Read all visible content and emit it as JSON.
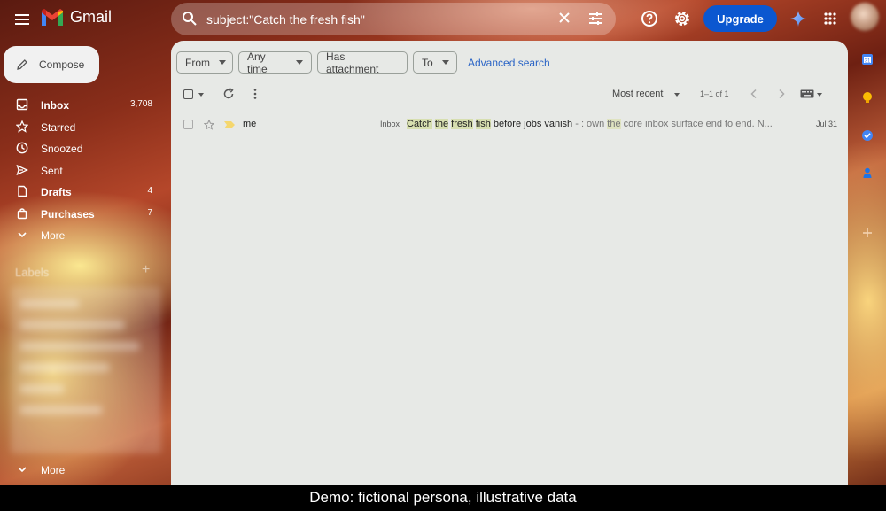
{
  "app": {
    "name": "Gmail"
  },
  "search": {
    "query": "subject:\"Catch the fresh fish\""
  },
  "header": {
    "upgrade_label": "Upgrade"
  },
  "compose_label": "Compose",
  "nav": [
    {
      "label": "Inbox",
      "count": "3,708",
      "icon": "inbox-icon"
    },
    {
      "label": "Starred",
      "count": "",
      "icon": "star-icon"
    },
    {
      "label": "Snoozed",
      "count": "",
      "icon": "clock-icon"
    },
    {
      "label": "Sent",
      "count": "",
      "icon": "send-icon"
    },
    {
      "label": "Drafts",
      "count": "4",
      "icon": "draft-icon"
    },
    {
      "label": "Purchases",
      "count": "7",
      "icon": "bag-icon"
    },
    {
      "label": "More",
      "count": "",
      "icon": "chevron-down-icon"
    }
  ],
  "labels_header": "Labels",
  "more_bottom": "More",
  "filters": {
    "from": "From",
    "any_time": "Any time",
    "has_attachment": "Has attachment",
    "to": "To",
    "advanced": "Advanced search"
  },
  "list": {
    "sort": "Most recent",
    "pager": "1–1 of 1",
    "rows": [
      {
        "sender": "me",
        "tag": "Inbox",
        "subject_pre": "Catch",
        "subject_w2": "the",
        "subject_w3": "fresh",
        "subject_w4": "fish",
        "subject_rest": "before jobs vanish",
        "snippet_a": " - : own ",
        "snippet_hl": "the",
        "snippet_b": " core inbox surface end to end. N...",
        "date": "Jul 31"
      }
    ]
  },
  "banner": "Demo: fictional persona, illustrative data",
  "colors": {
    "upgrade": "#0b57d0",
    "link": "#2a64c6",
    "highlight": "#d7dfb0"
  }
}
